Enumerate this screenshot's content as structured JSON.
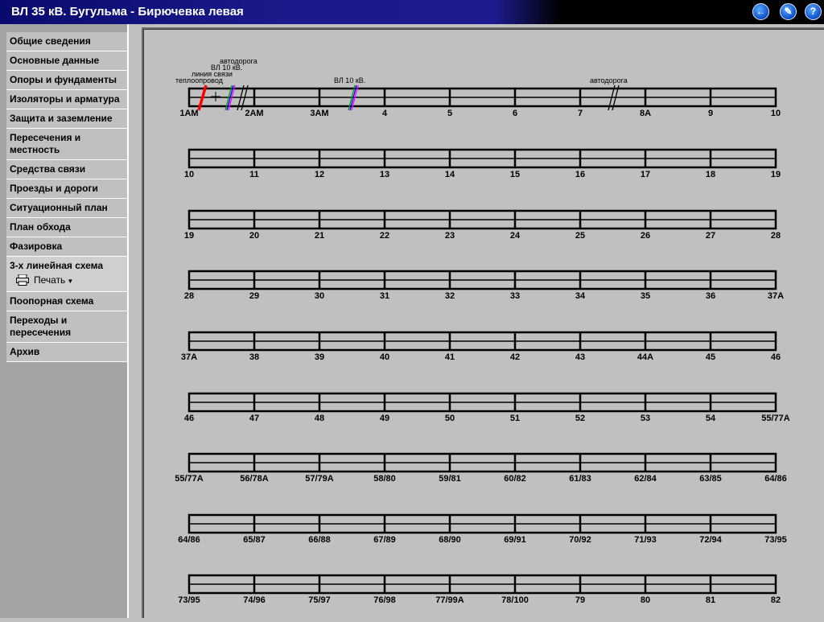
{
  "window": {
    "title": "ВЛ 35 кВ. Бугульма - Бирючевка левая"
  },
  "titlebar_buttons": [
    {
      "name": "back-button",
      "glyph": "←"
    },
    {
      "name": "edit-button",
      "glyph": "✎"
    },
    {
      "name": "help-button",
      "glyph": "?"
    }
  ],
  "sidebar": {
    "items": [
      {
        "label": "Общие сведения"
      },
      {
        "label": "Основные данные"
      },
      {
        "label": "Опоры и фундаменты"
      },
      {
        "label": "Изоляторы и арматура"
      },
      {
        "label": "Защита и заземление"
      },
      {
        "label": "Пересечения и местность"
      },
      {
        "label": "Средства связи"
      },
      {
        "label": "Проезды и дороги"
      },
      {
        "label": "Ситуационный план"
      },
      {
        "label": "План обхода"
      },
      {
        "label": "Фазировка"
      },
      {
        "label": "3-х линейная схема",
        "active": true
      },
      {
        "label": "Поопорная схема"
      },
      {
        "label": "Переходы и пересечения"
      },
      {
        "label": "Архив"
      }
    ],
    "print_label": "Печать"
  },
  "schema": {
    "rows": [
      [
        "1АМ",
        "",
        "2АМ",
        "3АМ",
        "4",
        "5",
        "6",
        "7",
        "8А",
        "9",
        "10"
      ],
      [
        "10",
        "11",
        "12",
        "13",
        "14",
        "15",
        "16",
        "17",
        "18",
        "19"
      ],
      [
        "19",
        "20",
        "21",
        "22",
        "23",
        "24",
        "25",
        "26",
        "27",
        "28"
      ],
      [
        "28",
        "29",
        "30",
        "31",
        "32",
        "33",
        "34",
        "35",
        "36",
        "37А"
      ],
      [
        "37А",
        "38",
        "39",
        "40",
        "41",
        "42",
        "43",
        "44А",
        "45",
        "46"
      ],
      [
        "46",
        "47",
        "48",
        "49",
        "50",
        "51",
        "52",
        "53",
        "54",
        "55/77А"
      ],
      [
        "55/77А",
        "56/78А",
        "57/79А",
        "58/80",
        "59/81",
        "60/82",
        "61/83",
        "62/84",
        "63/85",
        "64/86"
      ],
      [
        "64/86",
        "65/87",
        "66/88",
        "67/89",
        "68/90",
        "69/91",
        "70/92",
        "71/93",
        "72/94",
        "73/95"
      ],
      [
        "73/95",
        "74/96",
        "75/97",
        "76/98",
        "77/99А",
        "78/100",
        "79",
        "80",
        "81",
        "82"
      ]
    ],
    "crossings": [
      {
        "label": "теплоопровод",
        "kind": "heat-pipe",
        "color": "#ff0000"
      },
      {
        "label": "линия связи",
        "kind": "comm-line",
        "color": "#00a000"
      },
      {
        "label": "ВЛ 10 кВ.",
        "kind": "power-line",
        "color": "#0000ff"
      },
      {
        "label": "автодорога",
        "kind": "road",
        "color": "#000000"
      },
      {
        "label": "ВЛ 10 кВ.",
        "kind": "power-line",
        "color": "#0000ff"
      },
      {
        "label": "автодорога",
        "kind": "road",
        "color": "#000000"
      }
    ]
  }
}
